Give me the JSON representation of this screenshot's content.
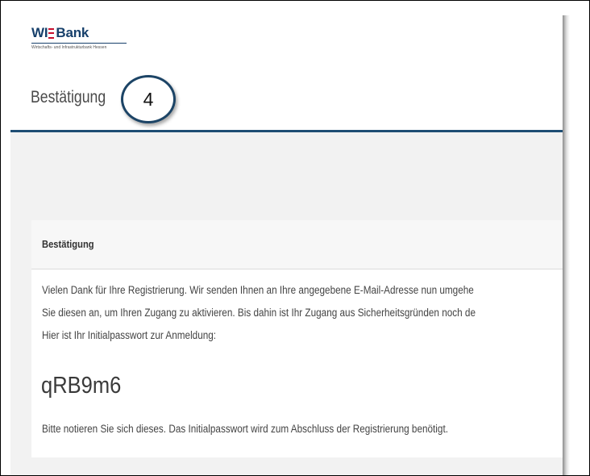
{
  "header": {
    "logo_wi": "WI",
    "logo_bank": "Bank",
    "logo_subtitle": "Wirtschafts- und Infrastrukturbank Hessen",
    "logo_bar_color": "#c8102e",
    "brand_color": "#17406b",
    "page_title": "Bestätigung",
    "step_number": "4"
  },
  "card": {
    "title": "Bestätigung",
    "line1": "Vielen Dank für Ihre Registrierung. Wir senden Ihnen an Ihre angegebene E-Mail-Adresse nun umgehe",
    "line2": "Sie diesen an, um Ihren Zugang zu aktivieren. Bis dahin ist Ihr Zugang aus Sicherheitsgründen noch de",
    "line3": "Hier ist Ihr Initialpasswort zur Anmeldung:",
    "password": "qRB9m6",
    "note": "Bitte notieren Sie sich dieses. Das Initialpasswort wird zum Abschluss der Registrierung benötigt."
  }
}
